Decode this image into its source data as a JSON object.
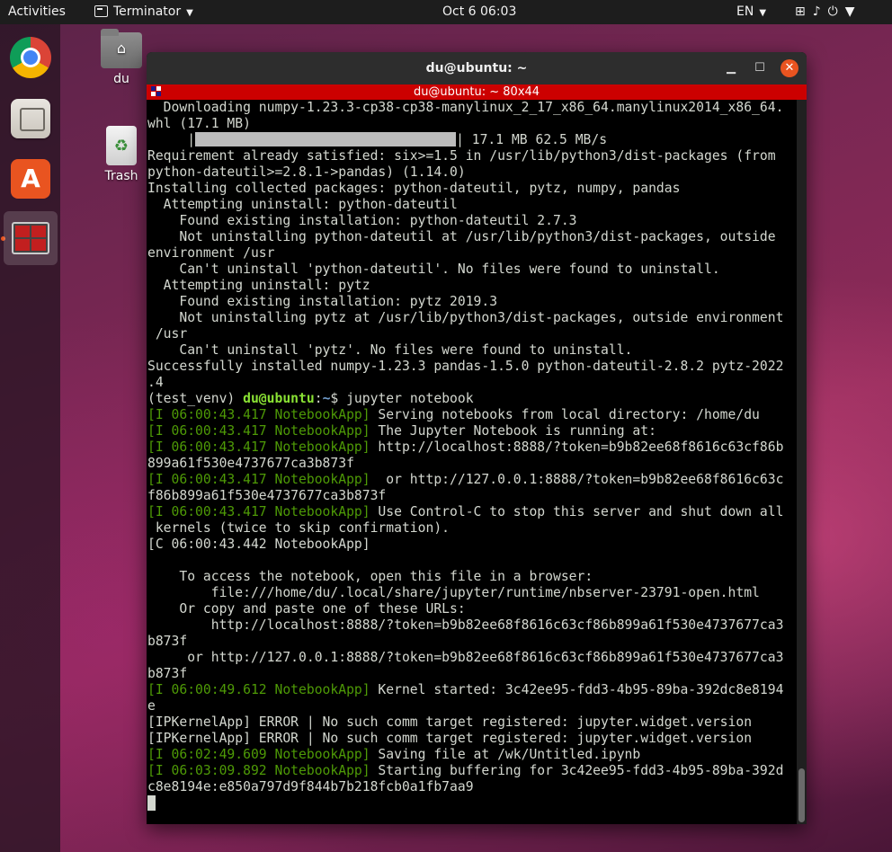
{
  "topbar": {
    "activities": "Activities",
    "app_menu": "Terminator",
    "clock": "Oct 6  06:03",
    "language": "EN"
  },
  "dock": {
    "items": [
      "chrome",
      "files",
      "ubuntu-software",
      "terminator"
    ]
  },
  "desktop": {
    "home_label": "du",
    "trash_label": "Trash"
  },
  "window": {
    "title": "du@ubuntu: ~",
    "tab_title": "du@ubuntu: ~ 80x44"
  },
  "terminal": {
    "line01": "  Downloading numpy-1.23.3-cp38-cp38-manylinux_2_17_x86_64.manylinux2014_x86_64.",
    "line02": "whl (17.1 MB)",
    "line03_pre": "     |",
    "line03_post": "| 17.1 MB 62.5 MB/s",
    "line04": "Requirement already satisfied: six>=1.5 in /usr/lib/python3/dist-packages (from",
    "line05": "python-dateutil>=2.8.1->pandas) (1.14.0)",
    "line06": "Installing collected packages: python-dateutil, pytz, numpy, pandas",
    "line07": "  Attempting uninstall: python-dateutil",
    "line08": "    Found existing installation: python-dateutil 2.7.3",
    "line09": "    Not uninstalling python-dateutil at /usr/lib/python3/dist-packages, outside",
    "line10": "environment /usr",
    "line11": "    Can't uninstall 'python-dateutil'. No files were found to uninstall.",
    "line12": "  Attempting uninstall: pytz",
    "line13": "    Found existing installation: pytz 2019.3",
    "line14": "    Not uninstalling pytz at /usr/lib/python3/dist-packages, outside environment",
    "line15": " /usr",
    "line16": "    Can't uninstall 'pytz'. No files were found to uninstall.",
    "line17": "Successfully installed numpy-1.23.3 pandas-1.5.0 python-dateutil-2.8.2 pytz-2022",
    "line18": ".4",
    "prompt_env": "(test_venv) ",
    "prompt_user": "du@ubuntu",
    "prompt_sep": ":",
    "prompt_path": "~",
    "prompt_cmd": "$ jupyter notebook",
    "tag_i1": "[I 06:00:43.417 NotebookApp]",
    "msg_i1": " Serving notebooks from local directory: /home/du",
    "tag_i2": "[I 06:00:43.417 NotebookApp]",
    "msg_i2": " The Jupyter Notebook is running at:",
    "tag_i3": "[I 06:00:43.417 NotebookApp]",
    "msg_i3": " http://localhost:8888/?token=b9b82ee68f8616c63cf86b",
    "line_i3b": "899a61f530e4737677ca3b873f",
    "tag_i4": "[I 06:00:43.417 NotebookApp]",
    "msg_i4": "  or http://127.0.0.1:8888/?token=b9b82ee68f8616c63c",
    "line_i4b": "f86b899a61f530e4737677ca3b873f",
    "tag_i5": "[I 06:00:43.417 NotebookApp]",
    "msg_i5": " Use Control-C to stop this server and shut down all",
    "line_i5b": " kernels (twice to skip confirmation).",
    "line_c1": "[C 06:00:43.442 NotebookApp]",
    "line_blank": "",
    "line_a1": "    To access the notebook, open this file in a browser:",
    "line_a2": "        file:///home/du/.local/share/jupyter/runtime/nbserver-23791-open.html",
    "line_a3": "    Or copy and paste one of these URLs:",
    "line_a4": "        http://localhost:8888/?token=b9b82ee68f8616c63cf86b899a61f530e4737677ca3",
    "line_a5": "b873f",
    "line_a6": "     or http://127.0.0.1:8888/?token=b9b82ee68f8616c63cf86b899a61f530e4737677ca3",
    "line_a7": "b873f",
    "tag_i6": "[I 06:00:49.612 NotebookApp]",
    "msg_i6": " Kernel started: 3c42ee95-fdd3-4b95-89ba-392dc8e8194",
    "line_i6b": "e",
    "line_e1": "[IPKernelApp] ERROR | No such comm target registered: jupyter.widget.version",
    "line_e2": "[IPKernelApp] ERROR | No such comm target registered: jupyter.widget.version",
    "tag_i7": "[I 06:02:49.609 NotebookApp]",
    "msg_i7": " Saving file at /wk/Untitled.ipynb",
    "tag_i8": "[I 06:03:09.892 NotebookApp]",
    "msg_i8": " Starting buffering for 3c42ee95-fdd3-4b95-89ba-392d",
    "line_i8b": "c8e8194e:e850a797d9f844b7b218fcb0a1fb7aa9"
  },
  "download_progress": 1.0,
  "colors": {
    "accent": "#e95420",
    "tab_bar": "#cc0000",
    "log_green": "#4e9a06"
  }
}
